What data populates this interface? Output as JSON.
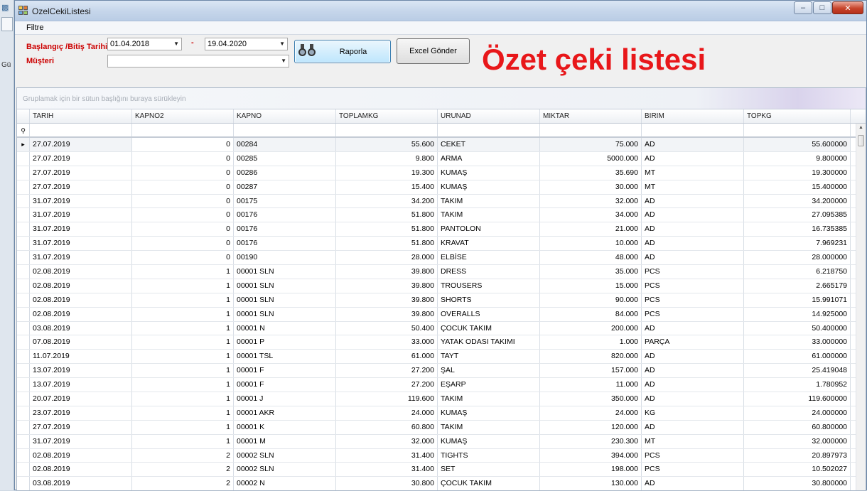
{
  "window": {
    "title": "OzelCekiListesi",
    "controls": {
      "minimize": "–",
      "maximize": "□",
      "close": "✕"
    }
  },
  "parent_app": {
    "partial_text": "Gü"
  },
  "menu": {
    "items": [
      {
        "label": "Filtre"
      }
    ]
  },
  "filter": {
    "date_label": "Başlangıç /Bitiş Tarihi",
    "customer_label": "Müşteri",
    "start_date": "01.04.2018",
    "end_date": "19.04.2020",
    "separator": "-",
    "customer_value": "",
    "report_button": "Raporla",
    "excel_button": "Excel Gönder",
    "heading": "Özet çeki listesi"
  },
  "grid": {
    "group_hint": "Gruplamak için bir sütun başlığını buraya sürükleyin",
    "columns": [
      "TARIH",
      "KAPNO2",
      "KAPNO",
      "TOPLAMKG",
      "URUNAD",
      "MIKTAR",
      "BIRIM",
      "TOPKG"
    ],
    "rows": [
      [
        "27.07.2019",
        "0",
        "00284",
        "55.600",
        "CEKET",
        "75.000",
        "AD",
        "55.600000"
      ],
      [
        "27.07.2019",
        "0",
        "00285",
        "9.800",
        "ARMA",
        "5000.000",
        "AD",
        "9.800000"
      ],
      [
        "27.07.2019",
        "0",
        "00286",
        "19.300",
        "KUMAŞ",
        "35.690",
        "MT",
        "19.300000"
      ],
      [
        "27.07.2019",
        "0",
        "00287",
        "15.400",
        "KUMAŞ",
        "30.000",
        "MT",
        "15.400000"
      ],
      [
        "31.07.2019",
        "0",
        "00175",
        "34.200",
        "TAKIM",
        "32.000",
        "AD",
        "34.200000"
      ],
      [
        "31.07.2019",
        "0",
        "00176",
        "51.800",
        "TAKIM",
        "34.000",
        "AD",
        "27.095385"
      ],
      [
        "31.07.2019",
        "0",
        "00176",
        "51.800",
        "PANTOLON",
        "21.000",
        "AD",
        "16.735385"
      ],
      [
        "31.07.2019",
        "0",
        "00176",
        "51.800",
        "KRAVAT",
        "10.000",
        "AD",
        "7.969231"
      ],
      [
        "31.07.2019",
        "0",
        "00190",
        "28.000",
        "ELBİSE",
        "48.000",
        "AD",
        "28.000000"
      ],
      [
        "02.08.2019",
        "1",
        "00001 SLN",
        "39.800",
        "DRESS",
        "35.000",
        "PCS",
        "6.218750"
      ],
      [
        "02.08.2019",
        "1",
        "00001 SLN",
        "39.800",
        "TROUSERS",
        "15.000",
        "PCS",
        "2.665179"
      ],
      [
        "02.08.2019",
        "1",
        "00001 SLN",
        "39.800",
        "SHORTS",
        "90.000",
        "PCS",
        "15.991071"
      ],
      [
        "02.08.2019",
        "1",
        "00001 SLN",
        "39.800",
        "OVERALLS",
        "84.000",
        "PCS",
        "14.925000"
      ],
      [
        "03.08.2019",
        "1",
        "00001 N",
        "50.400",
        "ÇOCUK TAKIM",
        "200.000",
        "AD",
        "50.400000"
      ],
      [
        "07.08.2019",
        "1",
        "00001 P",
        "33.000",
        "YATAK ODASI TAKIMI",
        "1.000",
        "PARÇA",
        "33.000000"
      ],
      [
        "11.07.2019",
        "1",
        "00001 TSL",
        "61.000",
        "TAYT",
        "820.000",
        "AD",
        "61.000000"
      ],
      [
        "13.07.2019",
        "1",
        "00001 F",
        "27.200",
        "ŞAL",
        "157.000",
        "AD",
        "25.419048"
      ],
      [
        "13.07.2019",
        "1",
        "00001 F",
        "27.200",
        "EŞARP",
        "11.000",
        "AD",
        "1.780952"
      ],
      [
        "20.07.2019",
        "1",
        "00001 J",
        "119.600",
        "TAKIM",
        "350.000",
        "AD",
        "119.600000"
      ],
      [
        "23.07.2019",
        "1",
        "00001 AKR",
        "24.000",
        "KUMAŞ",
        "24.000",
        "KG",
        "24.000000"
      ],
      [
        "27.07.2019",
        "1",
        "00001 K",
        "60.800",
        "TAKIM",
        "120.000",
        "AD",
        "60.800000"
      ],
      [
        "31.07.2019",
        "1",
        "00001 M",
        "32.000",
        "KUMAŞ",
        "230.300",
        "MT",
        "32.000000"
      ],
      [
        "02.08.2019",
        "2",
        "00002 SLN",
        "31.400",
        "TIGHTS",
        "394.000",
        "PCS",
        "20.897973"
      ],
      [
        "02.08.2019",
        "2",
        "00002 SLN",
        "31.400",
        "SET",
        "198.000",
        "PCS",
        "10.502027"
      ],
      [
        "03.08.2019",
        "2",
        "00002 N",
        "30.800",
        "ÇOCUK TAKIM",
        "130.000",
        "AD",
        "30.800000"
      ]
    ]
  }
}
